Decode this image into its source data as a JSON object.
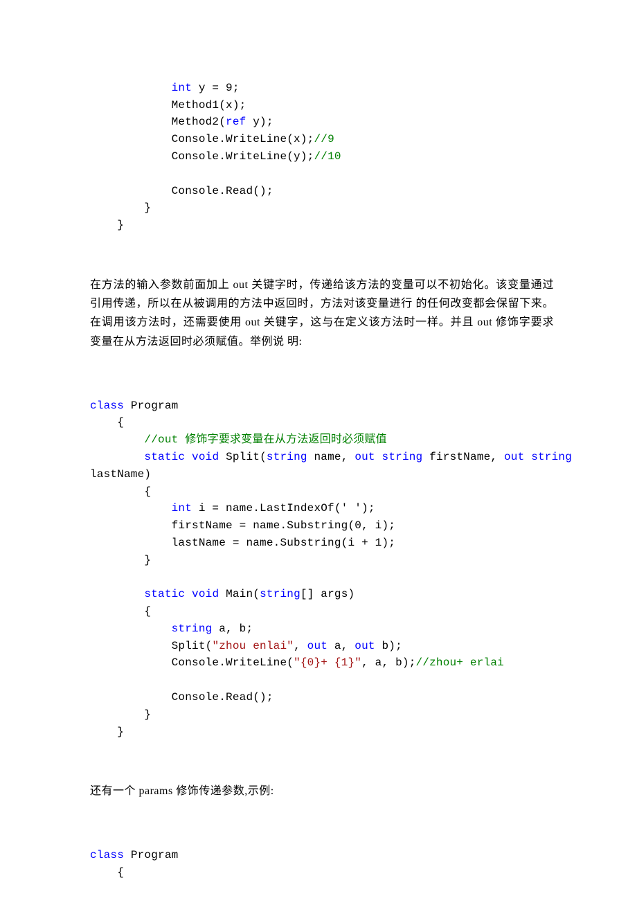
{
  "code1": {
    "l1a": "int",
    "l1b": " y = 9;",
    "l2": "Method1(x);",
    "l3a": "Method2(",
    "l3b": "ref",
    "l3c": " y);",
    "l4a": "Console.WriteLine(x);",
    "l4b": "//9",
    "l5a": "Console.WriteLine(y);",
    "l5b": "//10",
    "l6": "Console.Read();"
  },
  "para1": "在方法的输入参数前面加上 out 关键字时，传递给该方法的变量可以不初始化。该变量通过引用传递，所以在从被调用的方法中返回时，方法对该变量进行 的任何改变都会保留下来。在调用该方法时，还需要使用 out 关键字，这与在定义该方法时一样。并且 out 修饰字要求变量在从方法返回时必须赋值。举例说 明:",
  "code2": {
    "l1a": "class",
    "l1b": " Program",
    "lb": "{",
    "c1": "//out 修饰字要求变量在从方法返回时必须赋值",
    "s1a": "static",
    "s1b": "void",
    "s1c": " Split(",
    "s1d": "string",
    "s1e": " name, ",
    "s1f": "out",
    "s1g": "string",
    "s1h": " firstName, ",
    "s1i": "out",
    "s1j": "string",
    "s1last": "lastName)",
    "b1l1a": "int",
    "b1l1b": " i = name.LastIndexOf(' ');",
    "b1l2": "firstName = name.Substring(0, i);",
    "b1l3": "lastName = name.Substring(i + 1);",
    "rb": "}",
    "m1a": "static",
    "m1b": "void",
    "m1c": " Main(",
    "m1d": "string",
    "m1e": "[] args)",
    "m2a": "string",
    "m2b": " a, b;",
    "m3a": "Split(",
    "m3b": "\"zhou enlai\"",
    "m3c": ", ",
    "m3d": "out",
    "m3e": " a, ",
    "m3f": "out",
    "m3g": " b);",
    "m4a": "Console.WriteLine(",
    "m4b": "\"{0}+ {1}\"",
    "m4c": ", a, b);",
    "m4d": "//zhou+ erlai",
    "m5": "Console.Read();"
  },
  "para2": "还有一个 params 修饰传递参数,示例:",
  "code3": {
    "l1a": "class",
    "l1b": " Program",
    "lb": "{"
  }
}
